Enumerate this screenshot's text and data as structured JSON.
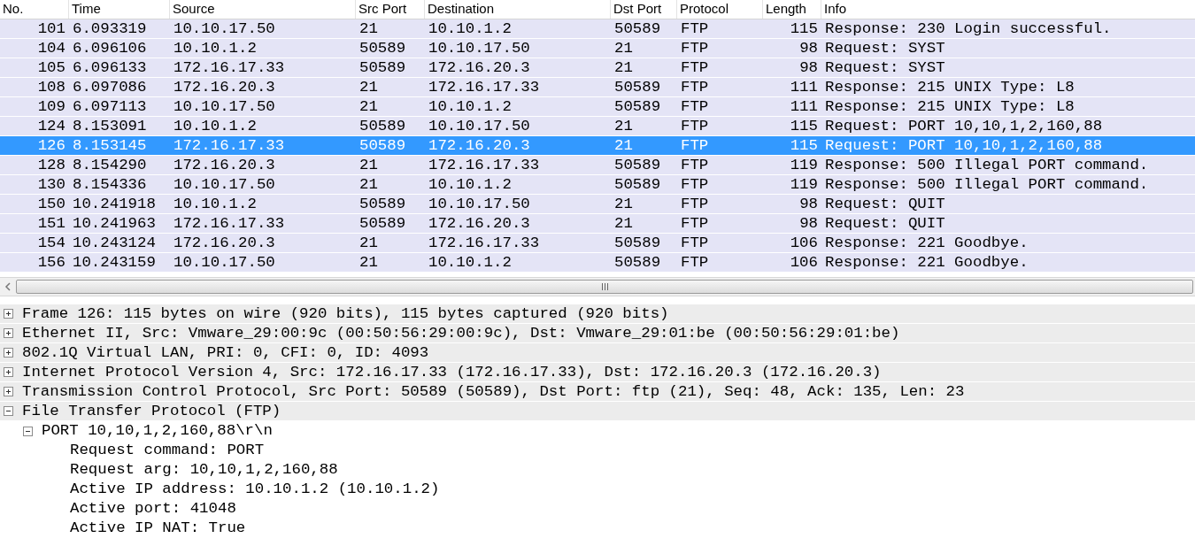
{
  "packet_list": {
    "columns": [
      "No.",
      "Time",
      "Source",
      "Src Port",
      "Destination",
      "Dst Port",
      "Protocol",
      "Length",
      "Info"
    ],
    "rows": [
      {
        "cells": [
          "101",
          "6.093319",
          "10.10.17.50",
          "21",
          "10.10.1.2",
          "50589",
          "FTP",
          "115",
          "Response: 230 Login successful."
        ],
        "selected": false
      },
      {
        "cells": [
          "104",
          "6.096106",
          "10.10.1.2",
          "50589",
          "10.10.17.50",
          "21",
          "FTP",
          "98",
          "Request: SYST"
        ],
        "selected": false
      },
      {
        "cells": [
          "105",
          "6.096133",
          "172.16.17.33",
          "50589",
          "172.16.20.3",
          "21",
          "FTP",
          "98",
          "Request: SYST"
        ],
        "selected": false
      },
      {
        "cells": [
          "108",
          "6.097086",
          "172.16.20.3",
          "21",
          "172.16.17.33",
          "50589",
          "FTP",
          "111",
          "Response: 215 UNIX Type: L8"
        ],
        "selected": false
      },
      {
        "cells": [
          "109",
          "6.097113",
          "10.10.17.50",
          "21",
          "10.10.1.2",
          "50589",
          "FTP",
          "111",
          "Response: 215 UNIX Type: L8"
        ],
        "selected": false
      },
      {
        "cells": [
          "124",
          "8.153091",
          "10.10.1.2",
          "50589",
          "10.10.17.50",
          "21",
          "FTP",
          "115",
          "Request: PORT 10,10,1,2,160,88"
        ],
        "selected": false
      },
      {
        "cells": [
          "126",
          "8.153145",
          "172.16.17.33",
          "50589",
          "172.16.20.3",
          "21",
          "FTP",
          "115",
          "Request: PORT 10,10,1,2,160,88"
        ],
        "selected": true
      },
      {
        "cells": [
          "128",
          "8.154290",
          "172.16.20.3",
          "21",
          "172.16.17.33",
          "50589",
          "FTP",
          "119",
          "Response: 500 Illegal PORT command."
        ],
        "selected": false
      },
      {
        "cells": [
          "130",
          "8.154336",
          "10.10.17.50",
          "21",
          "10.10.1.2",
          "50589",
          "FTP",
          "119",
          "Response: 500 Illegal PORT command."
        ],
        "selected": false
      },
      {
        "cells": [
          "150",
          "10.241918",
          "10.10.1.2",
          "50589",
          "10.10.17.50",
          "21",
          "FTP",
          "98",
          "Request: QUIT"
        ],
        "selected": false
      },
      {
        "cells": [
          "151",
          "10.241963",
          "172.16.17.33",
          "50589",
          "172.16.20.3",
          "21",
          "FTP",
          "98",
          "Request: QUIT"
        ],
        "selected": false
      },
      {
        "cells": [
          "154",
          "10.243124",
          "172.16.20.3",
          "21",
          "172.16.17.33",
          "50589",
          "FTP",
          "106",
          "Response: 221 Goodbye."
        ],
        "selected": false
      },
      {
        "cells": [
          "156",
          "10.243159",
          "10.10.17.50",
          "21",
          "10.10.1.2",
          "50589",
          "FTP",
          "106",
          "Response: 221 Goodbye."
        ],
        "selected": false
      }
    ]
  },
  "details": [
    {
      "label": "Frame 126: 115 bytes on wire (920 bits), 115 bytes captured (920 bits)",
      "expanded": false
    },
    {
      "label": "Ethernet II, Src: Vmware_29:00:9c (00:50:56:29:00:9c), Dst: Vmware_29:01:be (00:50:56:29:01:be)",
      "expanded": false
    },
    {
      "label": "802.1Q Virtual LAN, PRI: 0, CFI: 0, ID: 4093",
      "expanded": false
    },
    {
      "label": "Internet Protocol Version 4, Src: 172.16.17.33 (172.16.17.33), Dst: 172.16.20.3 (172.16.20.3)",
      "expanded": false
    },
    {
      "label": "Transmission Control Protocol, Src Port: 50589 (50589), Dst Port: ftp (21), Seq: 48, Ack: 135, Len: 23",
      "expanded": false
    },
    {
      "label": "File Transfer Protocol (FTP)",
      "expanded": true,
      "children": [
        {
          "label": "PORT 10,10,1,2,160,88\\r\\n",
          "expanded": true,
          "children": [
            {
              "label": "Request command: PORT"
            },
            {
              "label": "Request arg: 10,10,1,2,160,88"
            },
            {
              "label": "Active IP address: 10.10.1.2 (10.10.1.2)"
            },
            {
              "label": "Active port: 41048"
            },
            {
              "label": "Active IP NAT: True"
            }
          ]
        }
      ]
    }
  ]
}
